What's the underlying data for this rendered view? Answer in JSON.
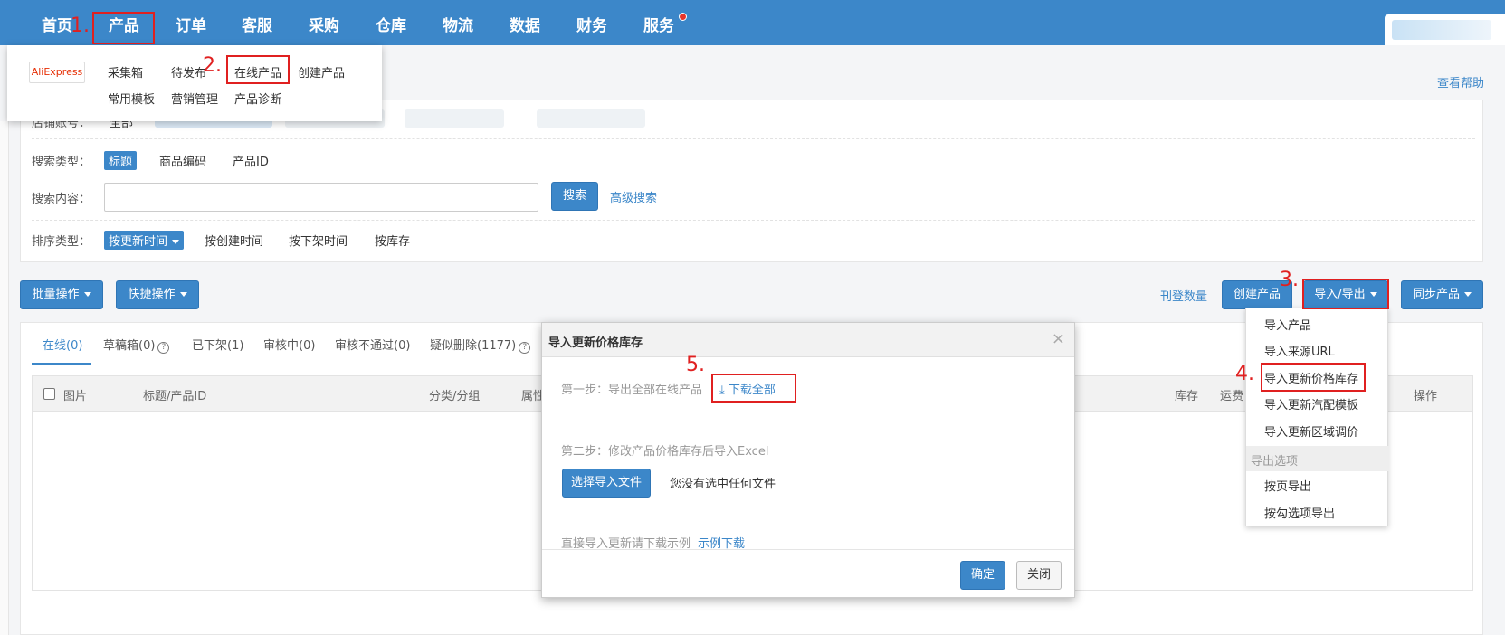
{
  "topnav": {
    "items": [
      "首页",
      "产品",
      "订单",
      "客服",
      "采购",
      "仓库",
      "物流",
      "数据",
      "财务",
      "服务"
    ],
    "accent": "#3c87c9"
  },
  "steps": [
    "1.",
    "2.",
    "3.",
    "4.",
    "5."
  ],
  "product_dropdown": {
    "logo": "AliExpress",
    "row1": [
      "采集箱",
      "待发布",
      "在线产品",
      "创建产品"
    ],
    "row2": [
      "常用模板",
      "营销管理",
      "产品诊断"
    ]
  },
  "help_link": "查看帮助",
  "filters": {
    "store_label": "店铺账号：",
    "store_all": "全部",
    "search_type_label": "搜索类型：",
    "search_types": [
      "标题",
      "商品编码",
      "产品ID"
    ],
    "search_content_label": "搜索内容：",
    "search_value": "",
    "search_button": "搜索",
    "advanced_search": "高级搜索",
    "sort_label": "排序类型：",
    "sort_options": [
      "按更新时间",
      "按创建时间",
      "按下架时间",
      "按库存"
    ]
  },
  "toolbar": {
    "batch": "批量操作",
    "quick": "快捷操作",
    "publish_count": "刊登数量",
    "create": "创建产品",
    "import_export": "导入/导出",
    "sync": "同步产品"
  },
  "tabs": [
    "在线(0)",
    "草稿箱(0)",
    "已下架(1)",
    "审核中(0)",
    "审核不通过(0)",
    "疑似删除(1177)"
  ],
  "table_headers": [
    "图片",
    "标题/产品ID",
    "分类/分组",
    "属性",
    "库存",
    "运费",
    "操作"
  ],
  "export_menu": {
    "import_items": [
      "导入产品",
      "导入来源URL",
      "导入更新价格库存",
      "导入更新汽配模板",
      "导入更新区域调价"
    ],
    "group_label": "导出选项",
    "export_items": [
      "按页导出",
      "按勾选项导出"
    ]
  },
  "modal": {
    "title": "导入更新价格库存",
    "close": "×",
    "step1": "第一步：导出全部在线产品",
    "download_all": "下载全部",
    "step2": "第二步：修改产品价格库存后导入Excel",
    "choose_file": "选择导入文件",
    "no_file": "您没有选中任何文件",
    "direct_import": "直接导入更新请下载示例",
    "sample_download": "示例下载",
    "confirm": "确定",
    "close_button": "关闭"
  }
}
